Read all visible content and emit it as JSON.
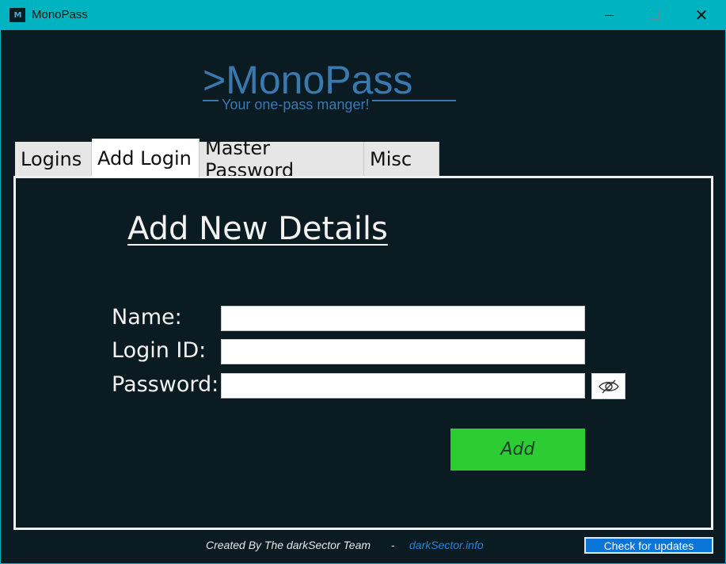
{
  "window": {
    "title": "MonoPass",
    "icon": "monopass-app-icon",
    "icon_text": "M"
  },
  "logo": {
    "title": ">MonoPass",
    "subtitle": "Your one-pass manger!"
  },
  "tabs": [
    {
      "label": "Logins",
      "active": false
    },
    {
      "label": "Add Login",
      "active": true
    },
    {
      "label": "Master Password",
      "active": false
    },
    {
      "label": "Misc",
      "active": false
    }
  ],
  "form": {
    "heading": "Add New Details",
    "name_label": "Name:",
    "name_value": "",
    "login_label": "Login ID:",
    "login_value": "",
    "password_label": "Password:",
    "password_value": "",
    "toggle_icon": "eye-slash-icon",
    "add_label": "Add"
  },
  "footer": {
    "credit": "Created By The darkSector Team",
    "separator": "-",
    "link": "darkSector.info",
    "update_label": "Check for updates"
  },
  "colors": {
    "background": "#0b1b22",
    "titlebar": "#00b3c1",
    "logo": "#3a78b0",
    "add_button": "#2ecc33",
    "update_button": "#0a74d8"
  }
}
